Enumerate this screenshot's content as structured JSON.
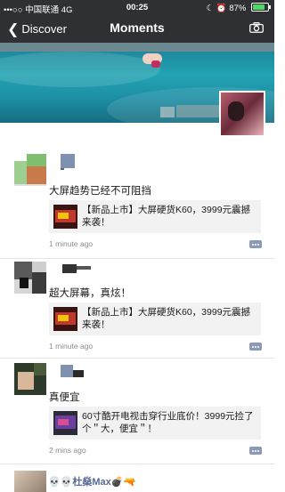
{
  "status_bar": {
    "carrier": "•••○○ 中国联通",
    "network": "4G",
    "time": "00:25",
    "battery": "87%",
    "battery_color": "#4cd964"
  },
  "nav": {
    "back_label": "Discover",
    "title": "Moments",
    "camera_icon": "camera-icon"
  },
  "posts": [
    {
      "text": "大屏趋势已经不可阻挡",
      "share_title": "【新品上市】大屏硬货K60，3999元震撼来袭！",
      "time": "1 minute ago"
    },
    {
      "text": "超大屏幕，真炫！",
      "share_title": "【新品上市】大屏硬货K60，3999元震撼来袭！",
      "time": "1 minute ago"
    },
    {
      "text": "真便宜",
      "share_title": "60寸酷开电视击穿行业底价！3999元捡了个＂大，便宜＂！",
      "time": "2 mins ago"
    }
  ],
  "post_partial": {
    "name": "💀💀杜燊Max💣🔫"
  },
  "colors": {
    "nav_bg": "#2f3033",
    "link_name": "#576b95",
    "card_bg": "#f2f2f2",
    "comment_icon": "#8b9ab4"
  }
}
